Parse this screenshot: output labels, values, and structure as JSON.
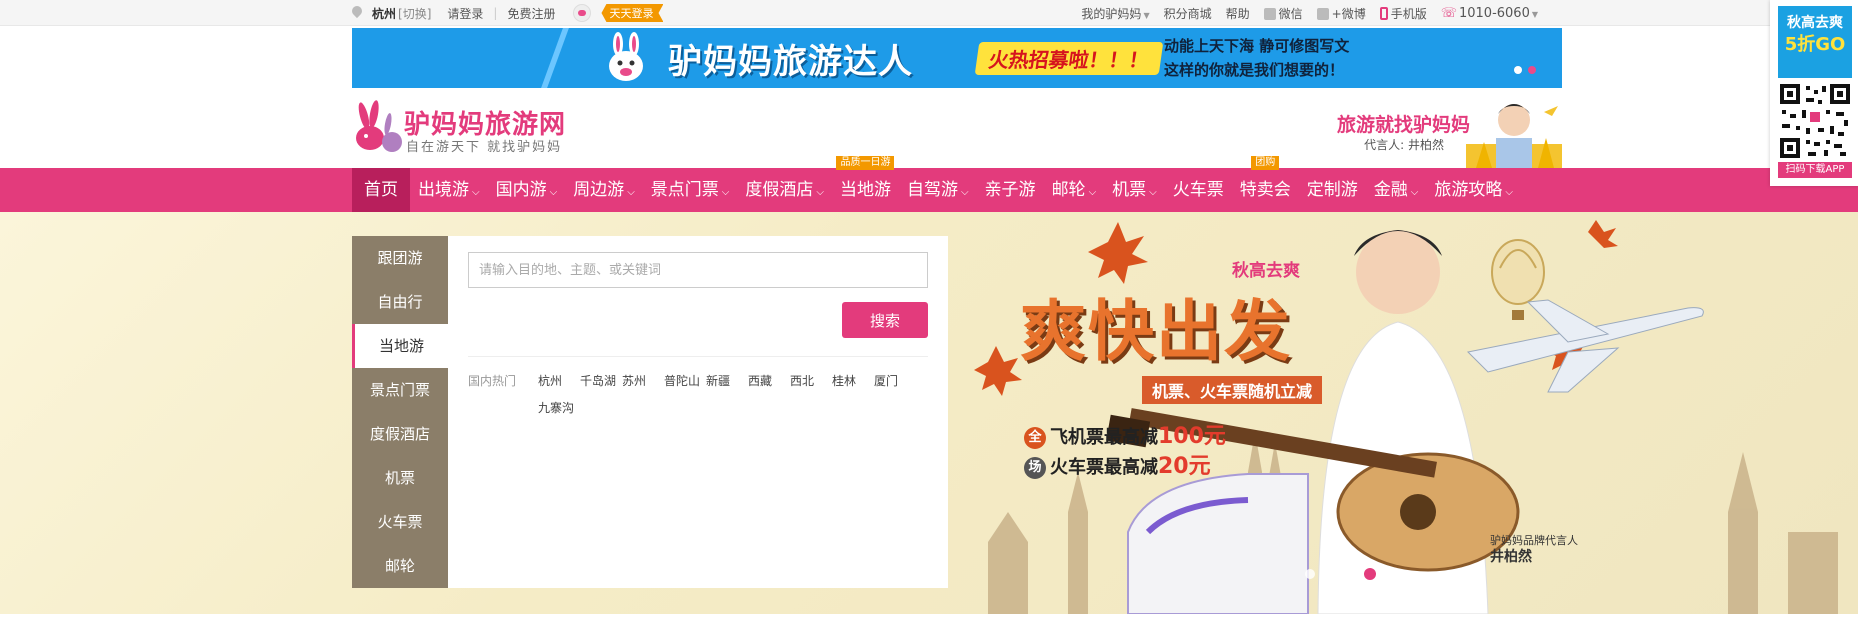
{
  "topbar": {
    "city": "杭州",
    "switch": "[切换]",
    "login": "请登录",
    "register": "免费注册",
    "daily_login": "天天登录",
    "my_account": "我的驴妈妈",
    "points_mall": "积分商城",
    "help": "帮助",
    "wechat": "微信",
    "weibo": "+微博",
    "mobile": "手机版",
    "phone": "1010-6060"
  },
  "promo": {
    "title": "驴妈妈旅游达人",
    "tag": "火热招募啦！！！",
    "line1": "动能上天下海 静可修图写文",
    "line2": "这样的你就是我们想要的！"
  },
  "logo": {
    "title": "驴妈妈旅游网",
    "subtitle": "自在游天下 就找驴妈妈",
    "slogan": "旅游就找驴妈妈",
    "spokesperson": "代言人: 井柏然"
  },
  "nav": {
    "items": [
      {
        "label": "首页",
        "dropdown": false
      },
      {
        "label": "出境游",
        "dropdown": true
      },
      {
        "label": "国内游",
        "dropdown": true
      },
      {
        "label": "周边游",
        "dropdown": true
      },
      {
        "label": "景点门票",
        "dropdown": true
      },
      {
        "label": "度假酒店",
        "dropdown": true
      },
      {
        "label": "当地游",
        "dropdown": false,
        "badge": "品质一日游"
      },
      {
        "label": "自驾游",
        "dropdown": true
      },
      {
        "label": "亲子游",
        "dropdown": false
      },
      {
        "label": "邮轮",
        "dropdown": true
      },
      {
        "label": "机票",
        "dropdown": true
      },
      {
        "label": "火车票",
        "dropdown": false
      },
      {
        "label": "特卖会",
        "dropdown": false,
        "badge": "团购"
      },
      {
        "label": "定制游",
        "dropdown": false
      },
      {
        "label": "金融",
        "dropdown": true
      },
      {
        "label": "旅游攻略",
        "dropdown": true
      }
    ]
  },
  "side_menu": {
    "items": [
      "跟团游",
      "自由行",
      "当地游",
      "景点门票",
      "度假酒店",
      "机票",
      "火车票",
      "邮轮"
    ],
    "active_index": 2
  },
  "search": {
    "placeholder": "请输入目的地、主题、或关键词",
    "button": "搜索",
    "hot_label": "国内热门",
    "hot_links": [
      "杭州",
      "千岛湖",
      "苏州",
      "普陀山",
      "新疆",
      "西藏",
      "西北",
      "桂林",
      "厦门",
      "九寨沟"
    ]
  },
  "hero": {
    "small_title": "秋高去爽",
    "main_title": "爽快出发",
    "sub_banner": "机票、火车票随机立减",
    "offer1_prefix": "全",
    "offer1": "飞机票最高减",
    "offer1_value": "100元",
    "offer2_prefix": "场",
    "offer2": "火车票最高减",
    "offer2_value": "20元",
    "brand_caption": "驴妈妈品牌代言人",
    "brand_name": "井柏然"
  },
  "qr": {
    "top_line1": "秋高去爽",
    "top_line2": "5折GO",
    "label": "扫码下载APP"
  },
  "colors": {
    "brand_pink": "#e33b7c",
    "nav_home": "#b81f5c",
    "badge_orange": "#f39800",
    "promo_blue": "#1e9be8",
    "side_menu": "#8b7e69"
  }
}
